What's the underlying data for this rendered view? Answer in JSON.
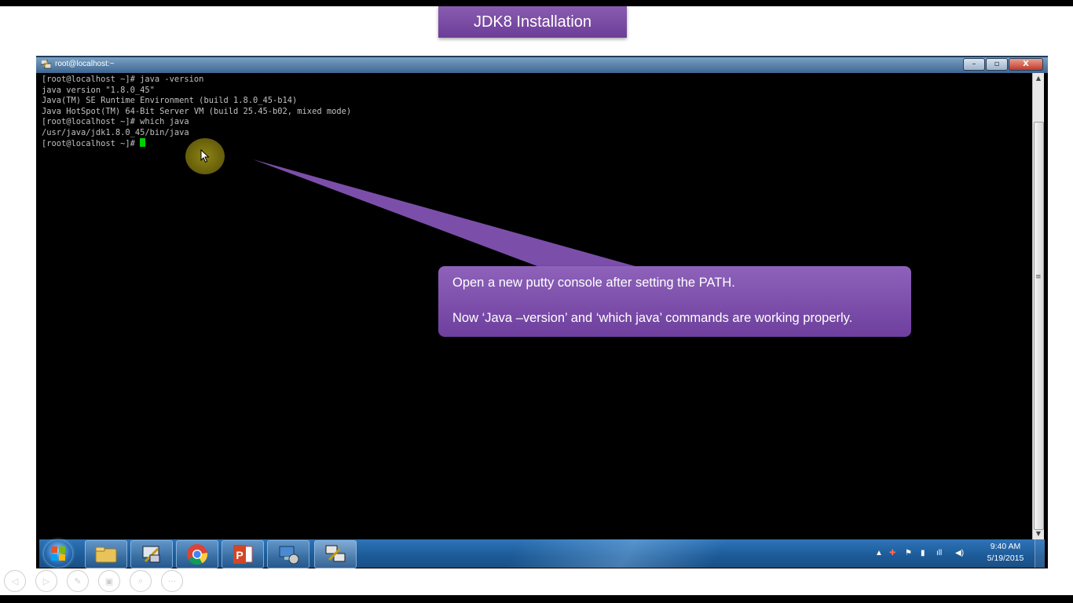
{
  "slide": {
    "title": "JDK8 Installation"
  },
  "window": {
    "title": "root@localhost:~",
    "minimize_glyph": "–",
    "maximize_glyph": "▫",
    "close_glyph": "X"
  },
  "terminal": {
    "lines": [
      "[root@localhost ~]# java -version",
      "java version \"1.8.0_45\"",
      "Java(TM) SE Runtime Environment (build 1.8.0_45-b14)",
      "Java HotSpot(TM) 64-Bit Server VM (build 25.45-b02, mixed mode)",
      "[root@localhost ~]# which java",
      "/usr/java/jdk1.8.0_45/bin/java"
    ],
    "prompt": "[root@localhost ~]# "
  },
  "callout": {
    "line1": "Open a new putty console after setting the PATH.",
    "line2": "Now ‘Java –version’ and  ‘which java’ commands are working properly."
  },
  "taskbar": {
    "pinned": [
      "file-explorer-icon",
      "putty-config-icon",
      "chrome-icon",
      "powerpoint-icon",
      "remote-desktop-icon",
      "putty-icon"
    ],
    "clock_time": "9:40 AM",
    "clock_date": "5/19/2015"
  },
  "colors": {
    "callout": "#7b4fa9",
    "terminal_bg": "#000000",
    "terminal_text": "#c0c0c0",
    "cursor": "#00d000",
    "taskbar": "#1f5f9e"
  }
}
